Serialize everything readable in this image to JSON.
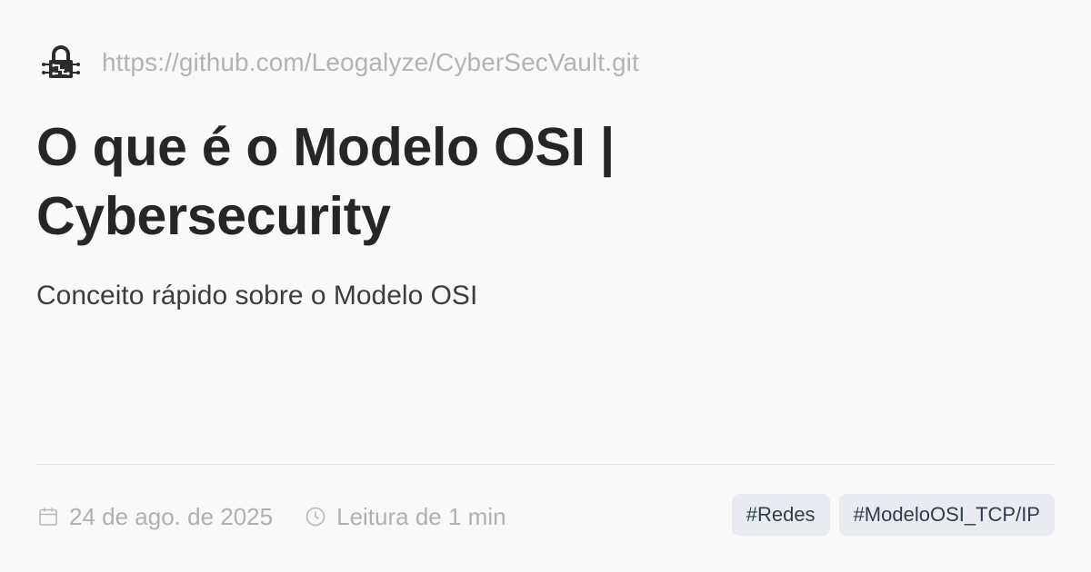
{
  "site": {
    "logo_icon": "lock-circuit-icon",
    "url": "https://github.com/Leogalyze/CyberSecVault.git"
  },
  "article": {
    "title": "O que é o Modelo OSI | Cybersecurity",
    "subtitle": "Conceito rápido sobre o Modelo OSI"
  },
  "meta": {
    "date_icon": "calendar-icon",
    "date": "24 de ago. de 2025",
    "reading_icon": "clock-icon",
    "reading_time": "Leitura de 1 min"
  },
  "tags": [
    {
      "label": "#Redes"
    },
    {
      "label": "#ModeloOSI_TCP/IP"
    }
  ],
  "colors": {
    "background": "#f9f9fa",
    "title": "#262626",
    "muted": "#b0b0b0",
    "tag_bg": "#e8ebef",
    "tag_text": "#2c3e50"
  }
}
